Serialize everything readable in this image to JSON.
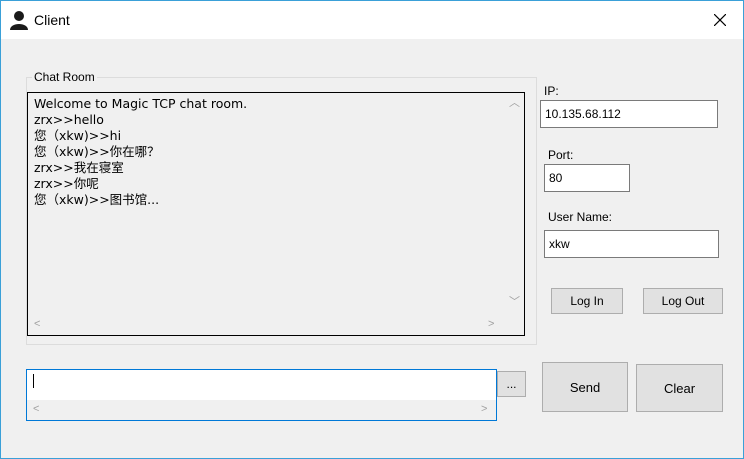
{
  "window": {
    "title": "Client"
  },
  "chat": {
    "group_label": "Chat Room",
    "lines": [
      "Welcome to Magic TCP chat room.",
      "zrx>>hello",
      "您（xkw)>>hi",
      "您（xkw)>>你在哪？",
      "zrx>>我在寝室",
      "zrx>>你呢",
      "您（xkw)>>图书馆..."
    ]
  },
  "connection": {
    "ip_label": "IP:",
    "ip_value": "10.135.68.112",
    "port_label": "Port:",
    "port_value": "80",
    "username_label": "User Name:",
    "username_value": "xkw",
    "login_label": "Log In",
    "logout_label": "Log Out"
  },
  "composer": {
    "message_value": "",
    "more_label": "...",
    "send_label": "Send",
    "clear_label": "Clear"
  }
}
